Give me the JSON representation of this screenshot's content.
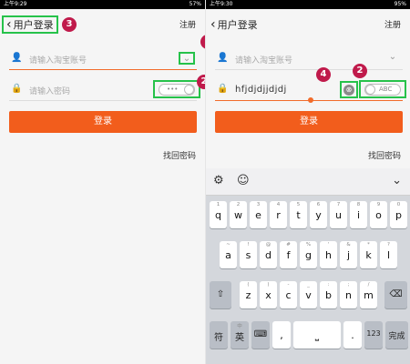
{
  "left": {
    "status_time": "上午9:29",
    "status_right": "57%",
    "nav": {
      "back_label": "用户登录",
      "register": "注册"
    },
    "username_placeholder": "请输入淘宝账号",
    "password_placeholder": "请输入密码",
    "password_toggle_text": "•••",
    "login_button": "登录",
    "forgot_password": "找回密码"
  },
  "right": {
    "status_time": "上午9:30",
    "status_right": "95%",
    "nav": {
      "back_label": "用户登录",
      "register": "注册"
    },
    "username_placeholder": "请输入淘宝账号",
    "password_value": "hfjdjdjjdjdj",
    "password_toggle_text": "ABC",
    "clear_icon": "⊗",
    "login_button": "登录",
    "forgot_password": "找回密码"
  },
  "badges": {
    "b1": "1",
    "b2": "2",
    "b3": "3",
    "b4": "4"
  },
  "keyboard": {
    "toolbar": {
      "settings": "⚙",
      "emoji": "☺",
      "collapse": "⌄"
    },
    "row1": [
      {
        "main": "q",
        "sub": "1"
      },
      {
        "main": "w",
        "sub": "2"
      },
      {
        "main": "e",
        "sub": "3"
      },
      {
        "main": "r",
        "sub": "4"
      },
      {
        "main": "t",
        "sub": "5"
      },
      {
        "main": "y",
        "sub": "6"
      },
      {
        "main": "u",
        "sub": "7"
      },
      {
        "main": "i",
        "sub": "8"
      },
      {
        "main": "o",
        "sub": "9"
      },
      {
        "main": "p",
        "sub": "0"
      }
    ],
    "row2": [
      {
        "main": "a",
        "sub": "~"
      },
      {
        "main": "s",
        "sub": "!"
      },
      {
        "main": "d",
        "sub": "@"
      },
      {
        "main": "f",
        "sub": "#"
      },
      {
        "main": "g",
        "sub": "%"
      },
      {
        "main": "h",
        "sub": "'"
      },
      {
        "main": "j",
        "sub": "&"
      },
      {
        "main": "k",
        "sub": "*"
      },
      {
        "main": "l",
        "sub": "?"
      }
    ],
    "row3": [
      {
        "main": "z",
        "sub": "("
      },
      {
        "main": "x",
        "sub": ")"
      },
      {
        "main": "c",
        "sub": "-"
      },
      {
        "main": "v",
        "sub": "_"
      },
      {
        "main": "b",
        "sub": ":"
      },
      {
        "main": "n",
        "sub": ";"
      },
      {
        "main": "m",
        "sub": "/"
      }
    ],
    "shift": "⇧",
    "backspace": "⌫",
    "bottom": {
      "symbol": "符",
      "lang": "英",
      "lang_sub": "中",
      "kbd": "⌨",
      "comma": ",",
      "space": "⎵",
      "period": ".",
      "nums": "123",
      "done": "完成"
    }
  }
}
